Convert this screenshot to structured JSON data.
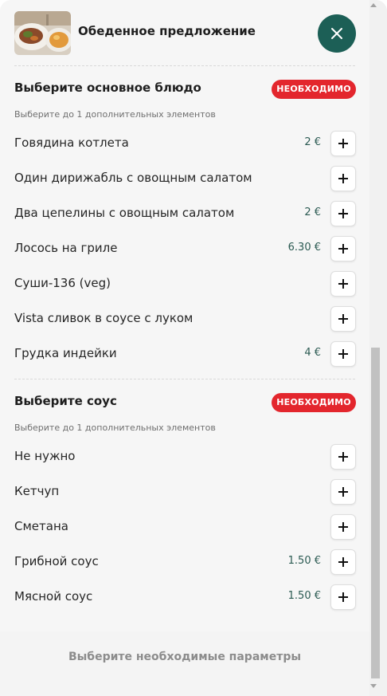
{
  "header": {
    "title": "Обеденное предложение",
    "thumbnail_icon": "meal-photo",
    "close_icon": "close-icon"
  },
  "sections": [
    {
      "title": "Выберите основное блюдо",
      "badge": "НЕОБХОДИМО",
      "hint": "Выберите до 1 дополнительных элементов",
      "items": [
        {
          "label": "Говядина котлета",
          "price": "2 €"
        },
        {
          "label": "Один дирижабль с овощным салатом",
          "price": ""
        },
        {
          "label": "Два цепелины с овощным салатом",
          "price": "2 €"
        },
        {
          "label": "Лосось на гриле",
          "price": "6.30 €"
        },
        {
          "label": "Суши-136 (veg)",
          "price": ""
        },
        {
          "label": "Vista сливок в соусе с луком",
          "price": ""
        },
        {
          "label": "Грудка индейки",
          "price": "4 €"
        }
      ]
    },
    {
      "title": "Выберите соус",
      "badge": "НЕОБХОДИМО",
      "hint": "Выберите до 1 дополнительных элементов",
      "items": [
        {
          "label": "Не нужно",
          "price": ""
        },
        {
          "label": "Кетчуп",
          "price": ""
        },
        {
          "label": "Сметана",
          "price": ""
        },
        {
          "label": "Грибной соус",
          "price": "1.50 €"
        },
        {
          "label": "Мясной соус",
          "price": "1.50 €"
        }
      ]
    }
  ],
  "footer": {
    "label": "Выберите необходимые параметры"
  },
  "colors": {
    "accent": "#1c5f56",
    "badge": "#e3262d",
    "price": "#2b5a52"
  }
}
